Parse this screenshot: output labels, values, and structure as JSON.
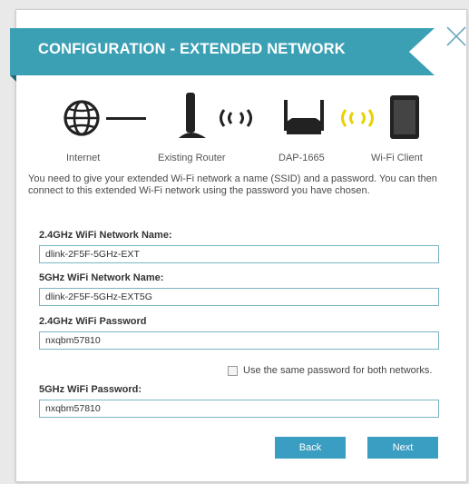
{
  "dialog": {
    "title": "CONFIGURATION - EXTENDED NETWORK",
    "accent_color": "#3ca0b5",
    "close_icon": "close-icon"
  },
  "diagram": {
    "labels": {
      "internet": "Internet",
      "router": "Existing Router",
      "device": "DAP-1665",
      "client": "Wi-Fi Client"
    },
    "icons": [
      "globe-icon",
      "router-icon",
      "wifi-signal-icon",
      "extender-icon",
      "wifi-signal-icon",
      "tablet-icon"
    ]
  },
  "intro_text": "You need to give your extended Wi-Fi network a name (SSID) and a password. You can then connect to this extended Wi-Fi network using the password you have chosen.",
  "form": {
    "ssid_24": {
      "label": "2.4GHz WiFi Network Name:",
      "value": "dlink-2F5F-5GHz-EXT"
    },
    "ssid_5": {
      "label": "5GHz WiFi Network Name:",
      "value": "dlink-2F5F-5GHz-EXT5G"
    },
    "pw_24": {
      "label": "2.4GHz WiFi Password",
      "value": "nxqbm57810"
    },
    "same_password": {
      "label": "Use the same password for both networks.",
      "checked": false
    },
    "pw_5": {
      "label": "5GHz WiFi Password:",
      "value": "nxqbm57810"
    }
  },
  "buttons": {
    "back": "Back",
    "next": "Next",
    "color": "#3a9ec2"
  }
}
